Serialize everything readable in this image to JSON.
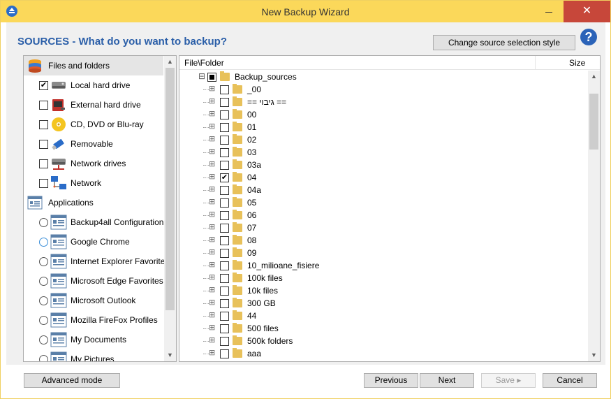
{
  "window": {
    "title": "New Backup Wizard",
    "close_glyph": "✕"
  },
  "header": {
    "heading": "SOURCES - What do you want to backup?",
    "change_style_label": "Change source selection style",
    "help_glyph": "?"
  },
  "sources": {
    "files_group": "Files and folders",
    "files_items": [
      {
        "label": "Local hard drive",
        "checked": true,
        "icon": "hard-drive-icon"
      },
      {
        "label": "External hard drive",
        "checked": false,
        "icon": "external-drive-icon"
      },
      {
        "label": "CD, DVD or Blu-ray",
        "checked": false,
        "icon": "disc-icon"
      },
      {
        "label": "Removable",
        "checked": false,
        "icon": "usb-icon"
      },
      {
        "label": "Network drives",
        "checked": false,
        "icon": "network-drive-icon"
      },
      {
        "label": "Network",
        "checked": false,
        "icon": "network-icon"
      }
    ],
    "apps_group": "Applications",
    "app_items": [
      {
        "label": "Backup4all Configuration"
      },
      {
        "label": "Google Chrome"
      },
      {
        "label": "Internet Explorer Favorites"
      },
      {
        "label": "Microsoft Edge Favorites"
      },
      {
        "label": "Microsoft Outlook"
      },
      {
        "label": "Mozilla FireFox Profiles"
      },
      {
        "label": "My Documents"
      },
      {
        "label": "My Pictures"
      }
    ]
  },
  "tree": {
    "col_file": "File\\Folder",
    "col_size": "Size",
    "root": {
      "label": "Backup_sources",
      "state": "partial",
      "expander": "⊟"
    },
    "children": [
      {
        "label": "_00",
        "checked": false
      },
      {
        "label": "== גיבוי ==",
        "checked": false
      },
      {
        "label": "00",
        "checked": false
      },
      {
        "label": "01",
        "checked": false
      },
      {
        "label": "02",
        "checked": false
      },
      {
        "label": "03",
        "checked": false
      },
      {
        "label": "03a",
        "checked": false
      },
      {
        "label": "04",
        "checked": true
      },
      {
        "label": "04a",
        "checked": false
      },
      {
        "label": "05",
        "checked": false
      },
      {
        "label": "06",
        "checked": false
      },
      {
        "label": "07",
        "checked": false
      },
      {
        "label": "08",
        "checked": false
      },
      {
        "label": "09",
        "checked": false
      },
      {
        "label": "10_milioane_fisiere",
        "checked": false
      },
      {
        "label": "100k files",
        "checked": false
      },
      {
        "label": "10k files",
        "checked": false
      },
      {
        "label": "300 GB",
        "checked": false
      },
      {
        "label": "44",
        "checked": false
      },
      {
        "label": "500 files",
        "checked": false
      },
      {
        "label": "500k folders",
        "checked": false
      },
      {
        "label": "aaa",
        "checked": false
      }
    ]
  },
  "footer": {
    "advanced_label": "Advanced mode",
    "previous_label": "Previous",
    "next_label": "Next",
    "save_label": "Save",
    "cancel_label": "Cancel"
  },
  "colors": {
    "accent": "#2a5ea8",
    "titlebar": "#fbd85a",
    "close": "#c7473a"
  }
}
